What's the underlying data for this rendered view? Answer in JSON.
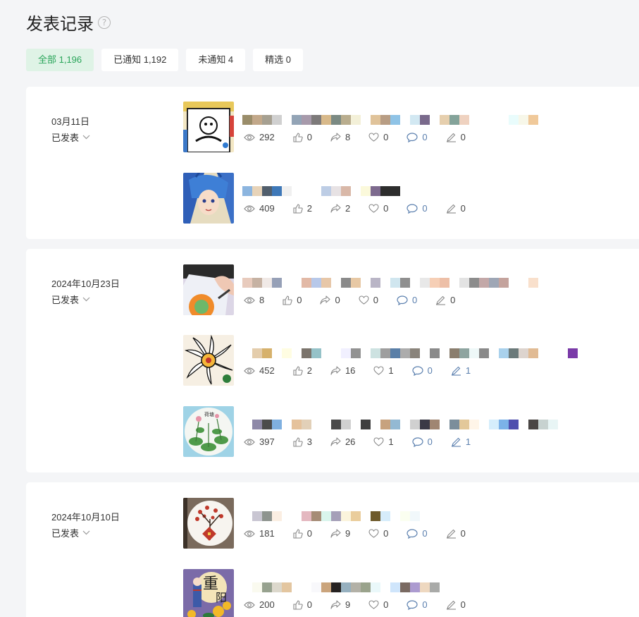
{
  "page": {
    "title": "发表记录",
    "help_icon": "question-circle-icon"
  },
  "tabs": [
    {
      "label": "全部 1,196",
      "active": true
    },
    {
      "label": "已通知 1,192",
      "active": false
    },
    {
      "label": "未通知 4",
      "active": false
    },
    {
      "label": "精选 0",
      "active": false
    }
  ],
  "colors": {
    "accent": "#2aa55a",
    "accent_bg": "#dff3e6",
    "comment": "#5a7fae"
  },
  "groups": [
    {
      "date": "03月11日",
      "status": "已发表",
      "posts": [
        {
          "views": "292",
          "likes": "0",
          "shares": "8",
          "favorites": "0",
          "comments": "0",
          "notes": "0"
        },
        {
          "views": "409",
          "likes": "2",
          "shares": "2",
          "favorites": "0",
          "comments": "0",
          "notes": "0"
        }
      ]
    },
    {
      "date": "2024年10月23日",
      "status": "已发表",
      "posts": [
        {
          "views": "8",
          "likes": "0",
          "shares": "0",
          "favorites": "0",
          "comments": "0",
          "notes": "0"
        },
        {
          "views": "452",
          "likes": "2",
          "shares": "16",
          "favorites": "1",
          "comments": "0",
          "notes": "1"
        },
        {
          "views": "397",
          "likes": "3",
          "shares": "26",
          "favorites": "1",
          "comments": "0",
          "notes": "1"
        }
      ]
    },
    {
      "date": "2024年10月10日",
      "status": "已发表",
      "posts": [
        {
          "views": "181",
          "likes": "0",
          "shares": "9",
          "favorites": "0",
          "comments": "0",
          "notes": "0"
        },
        {
          "views": "200",
          "likes": "0",
          "shares": "9",
          "favorites": "0",
          "comments": "0",
          "notes": "0"
        }
      ]
    }
  ]
}
